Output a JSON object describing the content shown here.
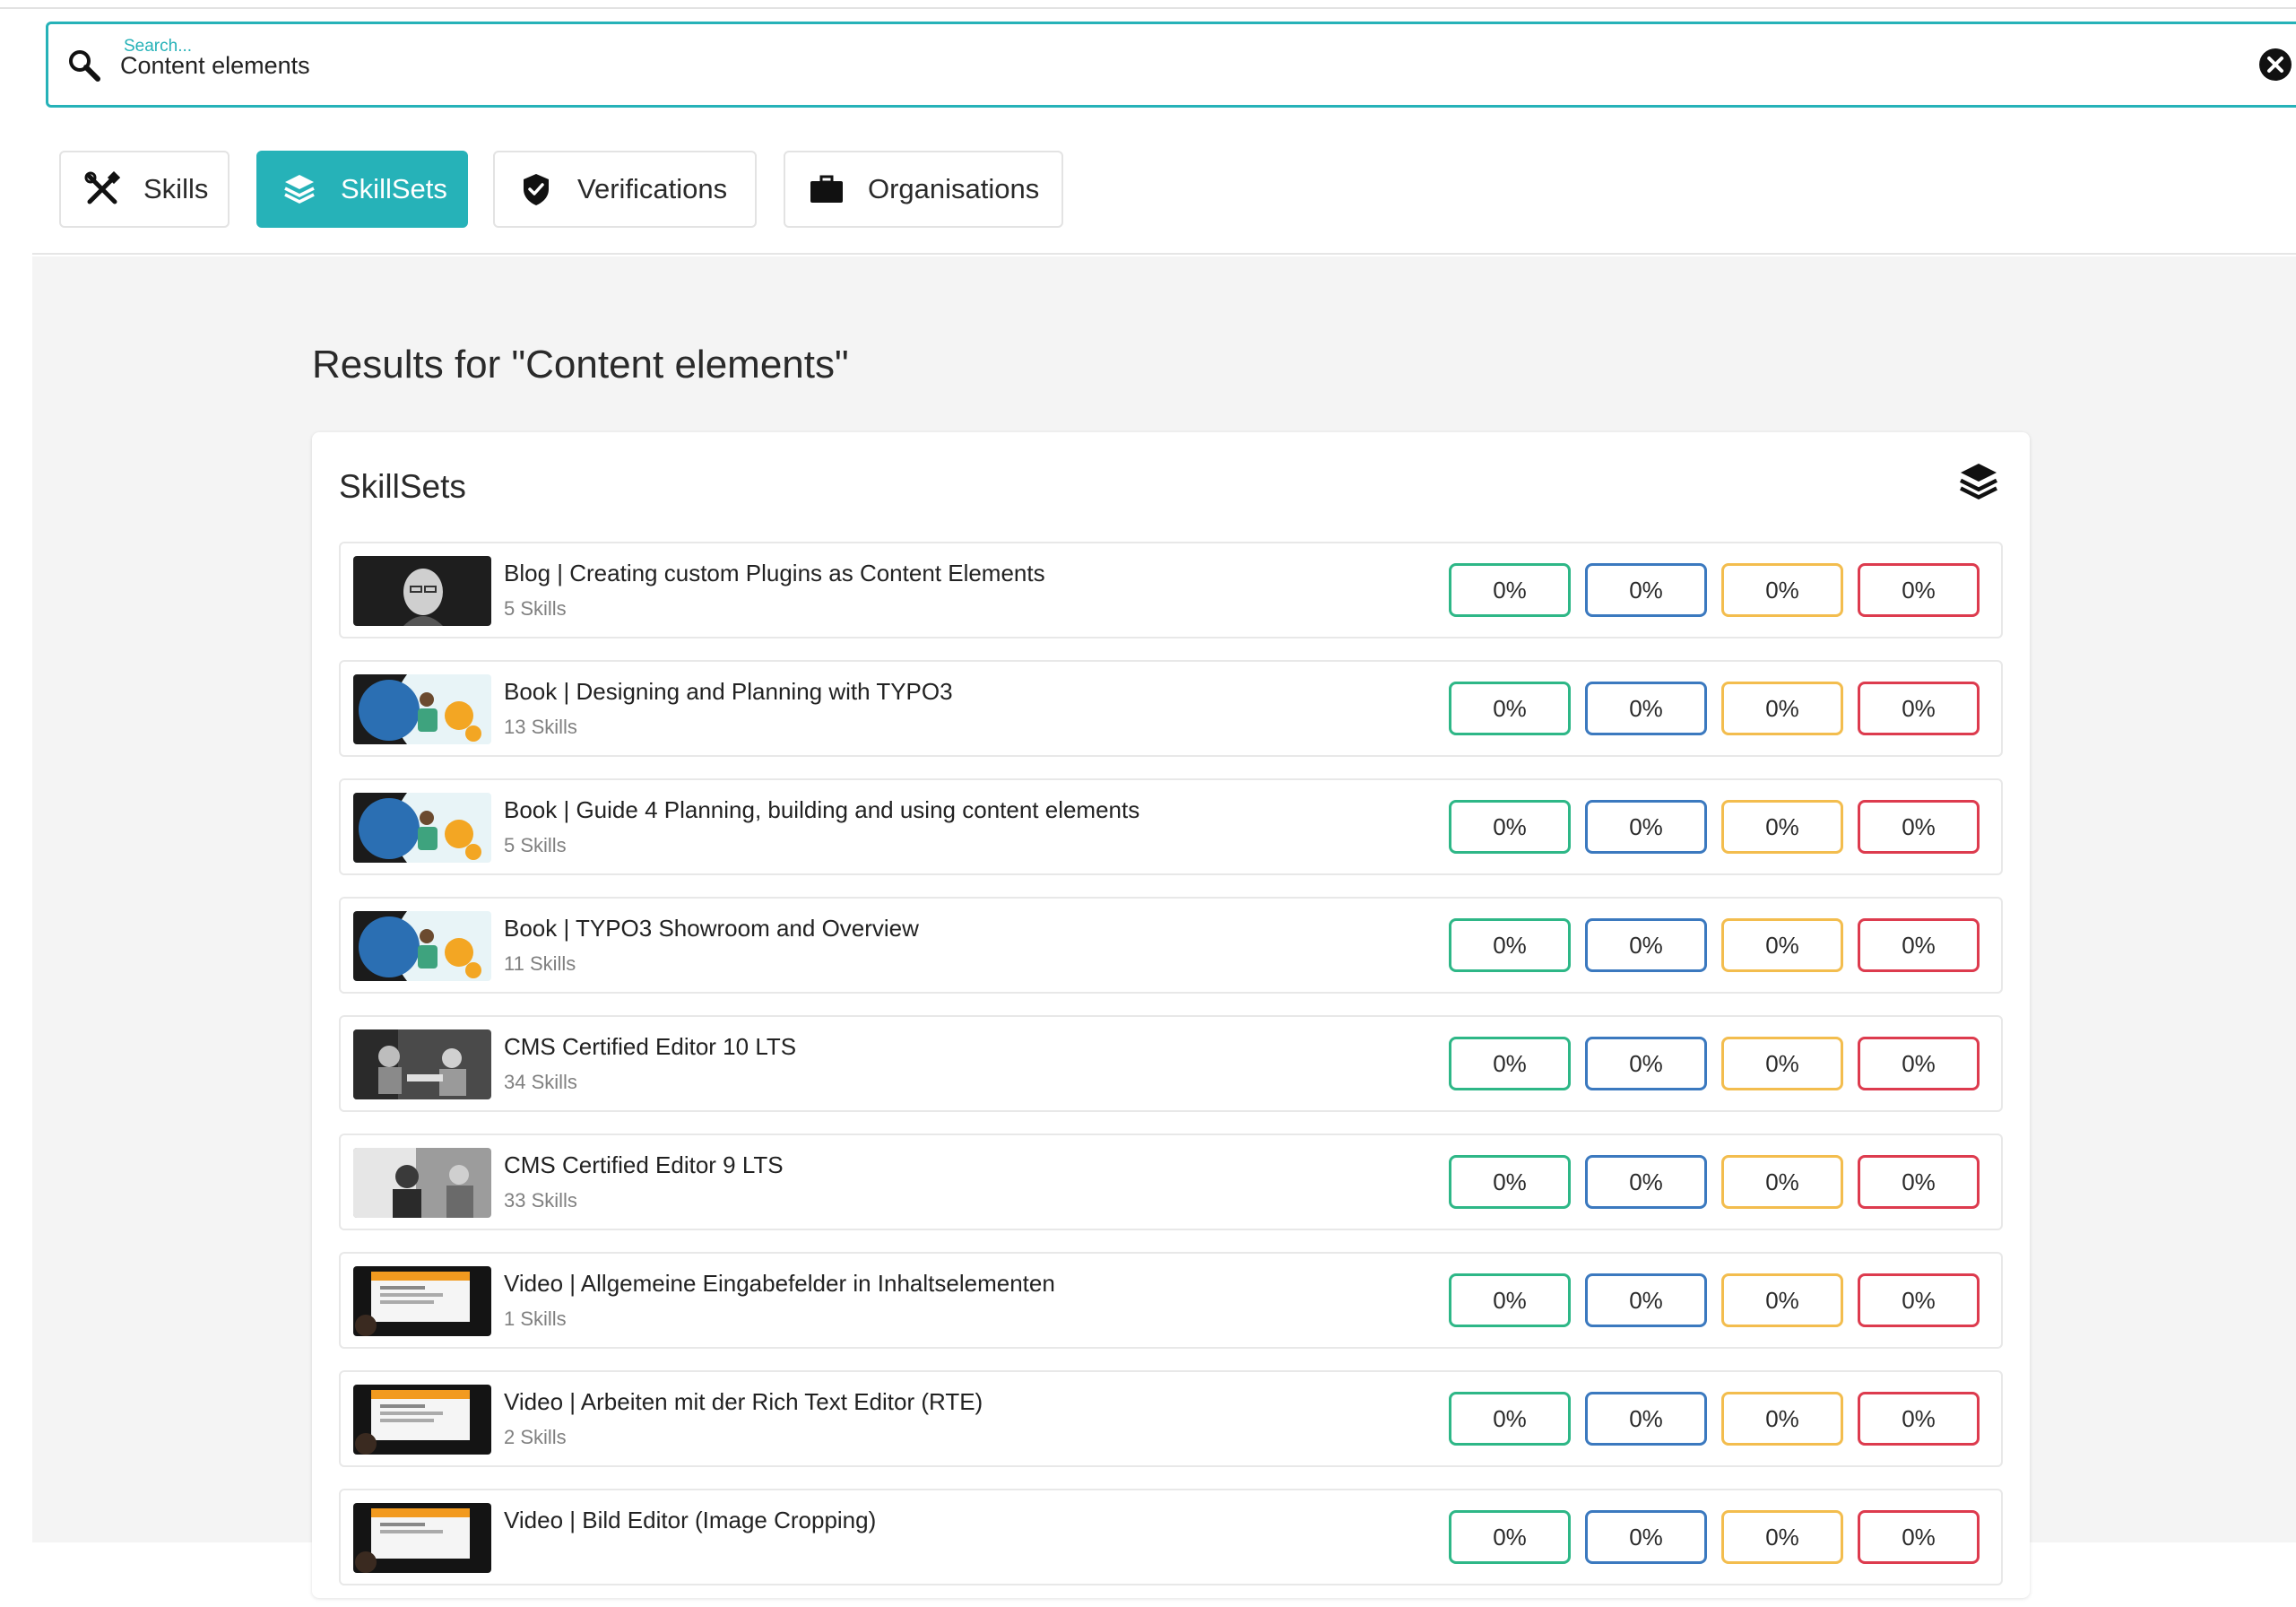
{
  "search": {
    "legend": "Search...",
    "value": "Content elements"
  },
  "tabs": [
    {
      "label": "Skills",
      "icon": "tools-icon",
      "active": false
    },
    {
      "label": "SkillSets",
      "icon": "layers-icon",
      "active": true
    },
    {
      "label": "Verifications",
      "icon": "shield-check-icon",
      "active": false
    },
    {
      "label": "Organisations",
      "icon": "briefcase-icon",
      "active": false
    }
  ],
  "results": {
    "heading": "Results for \"Content elements\"",
    "card_title": "SkillSets"
  },
  "colors": {
    "accent": "#26b2b8",
    "green": "#2eb787",
    "blue": "#3b79bf",
    "amber": "#f3bd4e",
    "red": "#dd3b4e"
  },
  "skillsets": [
    {
      "title": "Blog | Creating custom Plugins as Content Elements",
      "skills": "5 Skills",
      "thumb": "portrait",
      "pct": [
        "0%",
        "0%",
        "0%",
        "0%"
      ]
    },
    {
      "title": "Book | Designing and Planning with TYPO3",
      "skills": "13 Skills",
      "thumb": "book",
      "pct": [
        "0%",
        "0%",
        "0%",
        "0%"
      ]
    },
    {
      "title": "Book | Guide 4 Planning, building and using content elements",
      "skills": "5 Skills",
      "thumb": "book",
      "pct": [
        "0%",
        "0%",
        "0%",
        "0%"
      ]
    },
    {
      "title": "Book | TYPO3 Showroom and Overview",
      "skills": "11 Skills",
      "thumb": "book",
      "pct": [
        "0%",
        "0%",
        "0%",
        "0%"
      ]
    },
    {
      "title": "CMS Certified Editor 10 LTS",
      "skills": "34 Skills",
      "thumb": "photo",
      "pct": [
        "0%",
        "0%",
        "0%",
        "0%"
      ]
    },
    {
      "title": "CMS Certified Editor 9 LTS",
      "skills": "33 Skills",
      "thumb": "photo-light",
      "pct": [
        "0%",
        "0%",
        "0%",
        "0%"
      ]
    },
    {
      "title": "Video | Allgemeine Eingabefelder in Inhaltselementen",
      "skills": "1 Skills",
      "thumb": "video",
      "pct": [
        "0%",
        "0%",
        "0%",
        "0%"
      ]
    },
    {
      "title": "Video | Arbeiten mit der Rich Text Editor (RTE)",
      "skills": "2 Skills",
      "thumb": "video",
      "pct": [
        "0%",
        "0%",
        "0%",
        "0%"
      ]
    },
    {
      "title": "Video | Bild Editor (Image Cropping)",
      "skills": "",
      "thumb": "video",
      "pct": [
        "0%",
        "0%",
        "0%",
        "0%"
      ]
    }
  ]
}
